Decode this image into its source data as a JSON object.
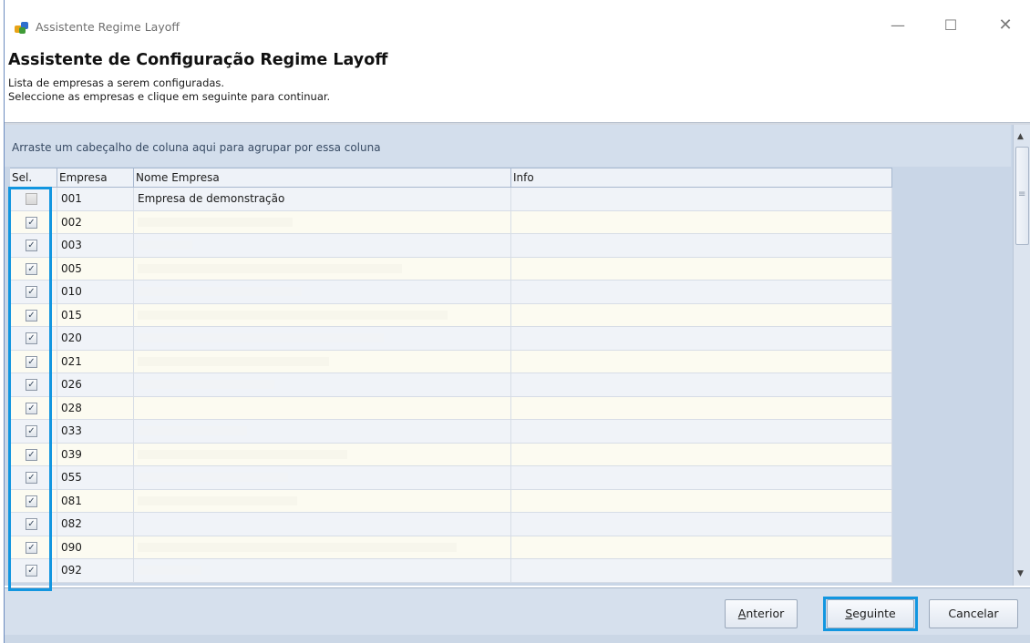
{
  "window": {
    "title": "Assistente Regime Layoff",
    "controls": {
      "minimize": "—",
      "maximize": "☐",
      "close": "✕"
    }
  },
  "header": {
    "title": "Assistente de Configuração Regime Layoff",
    "line1": "Lista de empresas a serem configuradas.",
    "line2": "Seleccione as empresas e clique em seguinte para continuar."
  },
  "grid": {
    "group_panel_text": "Arraste um cabeçalho de coluna aqui para agrupar por essa coluna",
    "columns": {
      "sel": "Sel.",
      "empresa": "Empresa",
      "nome": "Nome Empresa",
      "info": "Info"
    },
    "rows": [
      {
        "checked": false,
        "empresa": "001",
        "nome": "Empresa de demonstração",
        "info": ""
      },
      {
        "checked": true,
        "empresa": "002",
        "nome": "",
        "info": ""
      },
      {
        "checked": true,
        "empresa": "003",
        "nome": "",
        "info": ""
      },
      {
        "checked": true,
        "empresa": "005",
        "nome": "",
        "info": ""
      },
      {
        "checked": true,
        "empresa": "010",
        "nome": "",
        "info": ""
      },
      {
        "checked": true,
        "empresa": "015",
        "nome": "",
        "info": ""
      },
      {
        "checked": true,
        "empresa": "020",
        "nome": "",
        "info": ""
      },
      {
        "checked": true,
        "empresa": "021",
        "nome": "",
        "info": ""
      },
      {
        "checked": true,
        "empresa": "026",
        "nome": "",
        "info": ""
      },
      {
        "checked": true,
        "empresa": "028",
        "nome": "",
        "info": ""
      },
      {
        "checked": true,
        "empresa": "033",
        "nome": "",
        "info": ""
      },
      {
        "checked": true,
        "empresa": "039",
        "nome": "",
        "info": ""
      },
      {
        "checked": true,
        "empresa": "055",
        "nome": "",
        "info": ""
      },
      {
        "checked": true,
        "empresa": "081",
        "nome": "",
        "info": ""
      },
      {
        "checked": true,
        "empresa": "082",
        "nome": "",
        "info": ""
      },
      {
        "checked": true,
        "empresa": "090",
        "nome": "",
        "info": ""
      },
      {
        "checked": true,
        "empresa": "092",
        "nome": "",
        "info": ""
      }
    ]
  },
  "buttons": {
    "anterior_access": "A",
    "anterior_rest": "nterior",
    "seguinte_access": "S",
    "seguinte_rest": "eguinte",
    "cancelar": "Cancelar"
  },
  "colors": {
    "highlight": "#1296e0",
    "grid_background": "#c9d6e7",
    "row_odd": "#f0f3f8",
    "row_even": "#fcfbf1"
  },
  "icons": {
    "app": "app-icon",
    "scroll_up": "scroll-up-arrow-icon",
    "scroll_down": "scroll-down-arrow-icon"
  }
}
